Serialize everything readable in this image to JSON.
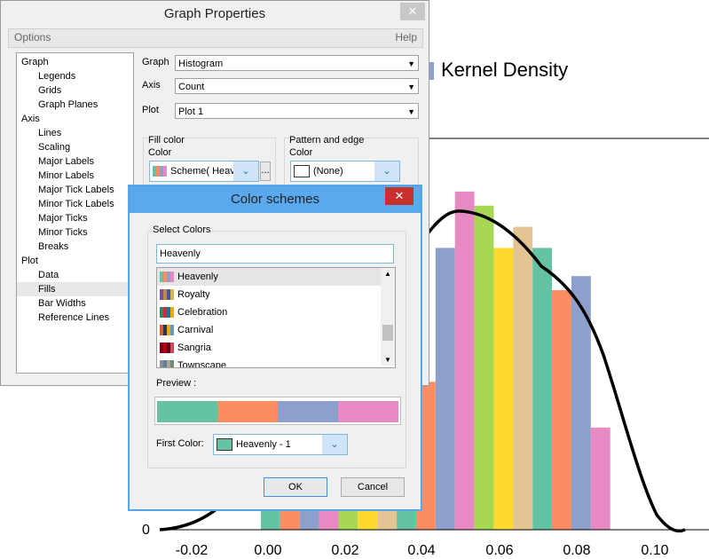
{
  "chart": {
    "title": "Kernel Density",
    "x_ticks": [
      "-0.02",
      "0.00",
      "0.02",
      "0.04",
      "0.06",
      "0.08",
      "0.10"
    ],
    "y_ticks": [
      "0"
    ],
    "bar_colors": [
      "#66c2a5",
      "#fc8d62",
      "#8da0cb",
      "#e78ac3",
      "#a6d854",
      "#ffd92f",
      "#e5c494"
    ]
  },
  "chart_data": {
    "type": "bar",
    "title": "Kernel Density",
    "x": [
      0.001,
      0.006,
      0.011,
      0.016,
      0.021,
      0.026,
      0.031,
      0.036,
      0.041,
      0.046,
      0.051,
      0.056,
      0.061,
      0.066,
      0.071,
      0.076,
      0.081,
      0.086
    ],
    "values_relative": [
      0.06,
      0.06,
      0.06,
      0.06,
      0.06,
      0.06,
      0.06,
      0.28,
      0.42,
      0.8,
      0.96,
      0.92,
      0.8,
      0.86,
      0.8,
      0.68,
      0.72,
      0.29
    ],
    "xlim": [
      -0.025,
      0.11
    ],
    "series": [
      {
        "values": [
          0.06,
          0.06,
          0.06,
          0.06,
          0.06,
          0.06,
          0.06,
          0.28,
          0.42,
          0.8,
          0.96,
          0.92,
          0.8,
          0.86,
          0.8,
          0.68,
          0.72,
          0.29
        ]
      }
    ]
  },
  "graph_props": {
    "title": "Graph Properties",
    "menu": {
      "options": "Options",
      "help": "Help"
    },
    "tree": [
      {
        "label": "Graph",
        "indent": 0
      },
      {
        "label": "Legends",
        "indent": 1
      },
      {
        "label": "Grids",
        "indent": 1
      },
      {
        "label": "Graph Planes",
        "indent": 1
      },
      {
        "label": "Axis",
        "indent": 0
      },
      {
        "label": "Lines",
        "indent": 1
      },
      {
        "label": "Scaling",
        "indent": 1
      },
      {
        "label": "Major Labels",
        "indent": 1
      },
      {
        "label": "Minor Labels",
        "indent": 1
      },
      {
        "label": "Major Tick Labels",
        "indent": 1
      },
      {
        "label": "Minor Tick Labels",
        "indent": 1
      },
      {
        "label": "Major Ticks",
        "indent": 1
      },
      {
        "label": "Minor Ticks",
        "indent": 1
      },
      {
        "label": "Breaks",
        "indent": 1
      },
      {
        "label": "Plot",
        "indent": 0
      },
      {
        "label": "Data",
        "indent": 1
      },
      {
        "label": "Fills",
        "indent": 1,
        "selected": true
      },
      {
        "label": "Bar Widths",
        "indent": 1
      },
      {
        "label": "Reference Lines",
        "indent": 1
      }
    ],
    "graph_label": "Graph",
    "graph_value": "Histogram",
    "axis_label": "Axis",
    "axis_value": "Count",
    "plot_label": "Plot",
    "plot_value": "Plot 1",
    "fill_color_group": "Fill color",
    "fill_color_label": "Color",
    "fill_color_value": "Scheme( Heav",
    "fill_more": "...",
    "pattern_group": "Pattern and edge",
    "pattern_color_label": "Color",
    "pattern_color_value": "(None)"
  },
  "color_schemes": {
    "title": "Color schemes",
    "select_group": "Select Colors",
    "selected_input": "Heavenly",
    "schemes": [
      {
        "name": "Heavenly",
        "colors": [
          "#66c2a5",
          "#fc8d62",
          "#8da0cb",
          "#e78ac3"
        ],
        "selected": true
      },
      {
        "name": "Royalty",
        "colors": [
          "#7b4f9e",
          "#c08a3e",
          "#3f5b9e",
          "#d9b44a"
        ]
      },
      {
        "name": "Celebration",
        "colors": [
          "#2e8b57",
          "#d7263d",
          "#1f6fb2",
          "#f2a900"
        ]
      },
      {
        "name": "Carnival",
        "colors": [
          "#e4572e",
          "#29335c",
          "#f3a712",
          "#669bbc"
        ]
      },
      {
        "name": "Sangria",
        "colors": [
          "#7a0019",
          "#b3001b",
          "#5c0a1a",
          "#d1495b"
        ]
      },
      {
        "name": "Townscape",
        "colors": [
          "#8c8c8c",
          "#5b7fa3",
          "#b0a48c",
          "#6d8b74"
        ]
      }
    ],
    "preview_label": "Preview :",
    "preview_colors": [
      "#66c2a5",
      "#fc8d62",
      "#8da0cb",
      "#e78ac3"
    ],
    "first_color_label": "First Color:",
    "first_color_value": "Heavenly -  1",
    "ok": "OK",
    "cancel": "Cancel"
  }
}
